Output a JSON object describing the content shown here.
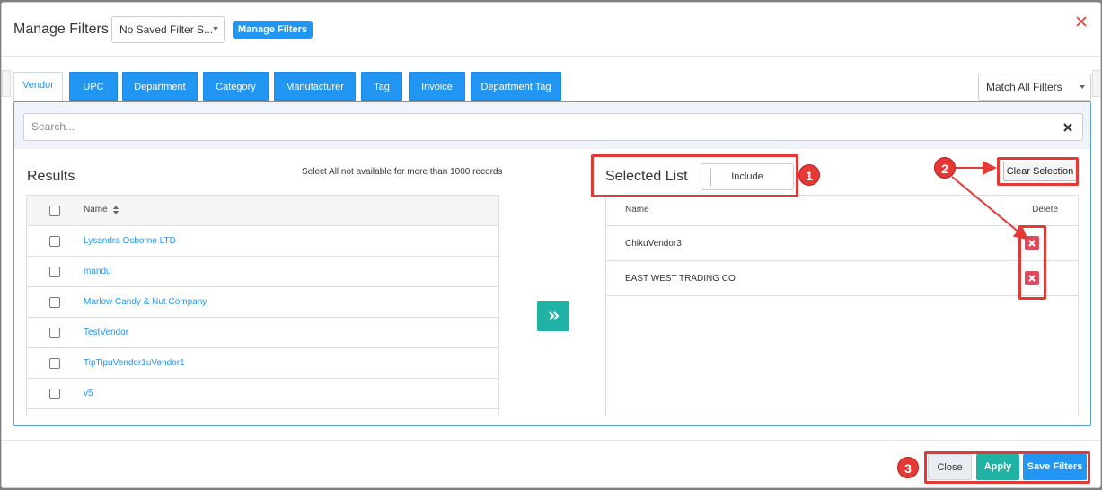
{
  "header": {
    "title": "Manage Filters",
    "saved_filter_value": "No Saved Filter S...",
    "manage_button": "Manage Filters"
  },
  "tabs": [
    {
      "label": "Vendor",
      "active": true
    },
    {
      "label": "UPC"
    },
    {
      "label": "Department"
    },
    {
      "label": "Category"
    },
    {
      "label": "Manufacturer"
    },
    {
      "label": "Tag"
    },
    {
      "label": "Invoice"
    },
    {
      "label": "Department Tag"
    }
  ],
  "match_select": "Match All Filters",
  "search": {
    "placeholder": "Search..."
  },
  "results": {
    "title": "Results",
    "note": "Select All not available for more than 1000 records",
    "column_name": "Name",
    "rows": [
      "Lysandra Osborne LTD",
      "mandu",
      "Marlow Candy & Nut Company",
      "TestVendor",
      "TipTipuVendor1uVendor1",
      "v5"
    ]
  },
  "selected": {
    "title": "Selected List",
    "include_label": "Include",
    "clear_label": "Clear Selection",
    "column_name": "Name",
    "column_delete": "Delete",
    "rows": [
      "ChikuVendor3",
      "EAST WEST TRADING CO"
    ]
  },
  "footer": {
    "close": "Close",
    "apply": "Apply",
    "save": "Save Filters"
  },
  "annotations": [
    "1",
    "2",
    "3"
  ],
  "colors": {
    "primary": "#2196f3",
    "teal": "#20b2a4",
    "danger": "#e04a5f",
    "annotation": "#e53935"
  }
}
